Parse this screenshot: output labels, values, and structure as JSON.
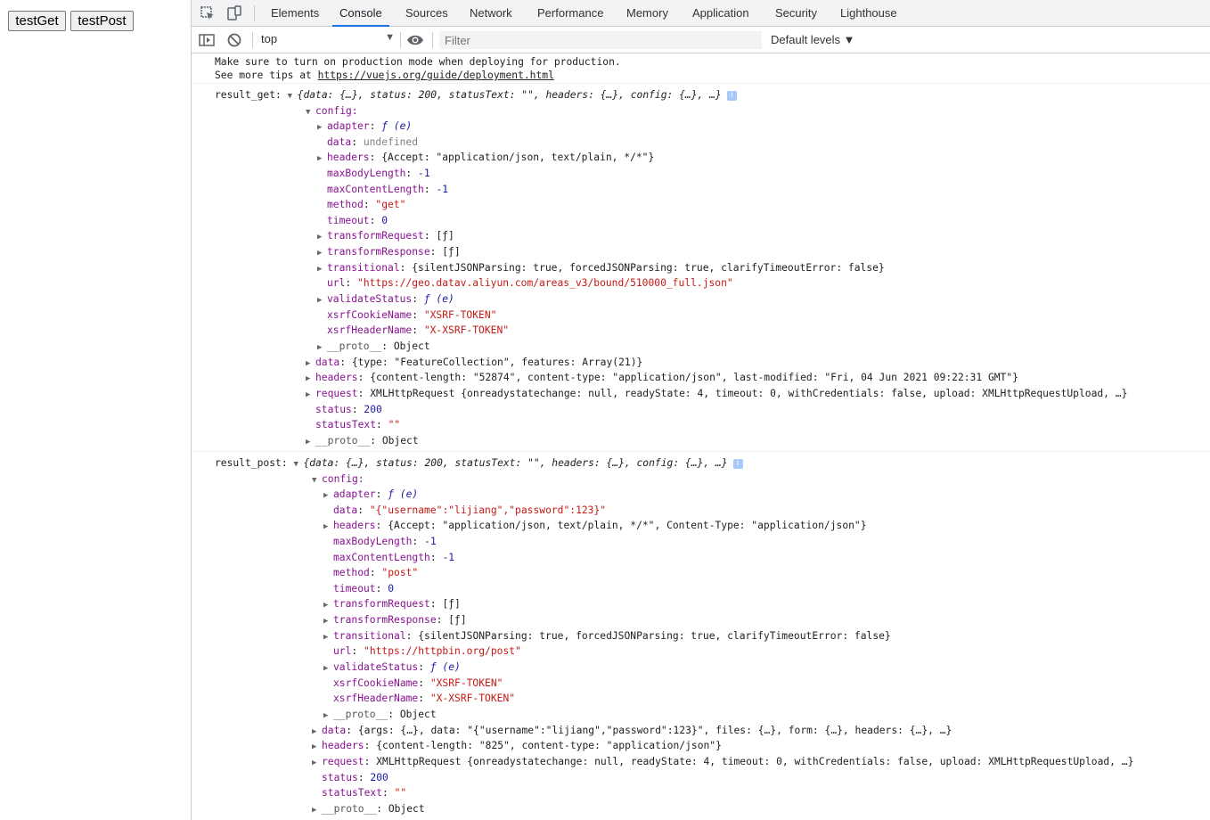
{
  "page": {
    "buttons": [
      "testGet",
      "testPost"
    ]
  },
  "devtools": {
    "tabs": [
      "Elements",
      "Console",
      "Sources",
      "Network",
      "Performance",
      "Memory",
      "Application",
      "Security",
      "Lighthouse"
    ],
    "active_tab": "Console",
    "context": "top",
    "filter_placeholder": "Filter",
    "levels": "Default levels ▼",
    "accent": "#1a73e8"
  },
  "console": {
    "intro": {
      "line1": "Make sure to turn on production mode when deploying for production.",
      "line2_prefix": "See more tips at ",
      "line2_link": "https://vuejs.org/guide/deployment.html"
    },
    "result_get": {
      "label": "result_get:",
      "summary": "{data: {…}, status: 200, statusText: \"\", headers: {…}, config: {…}, …}",
      "config_label": "config:",
      "config": {
        "adapter": "ƒ (e)",
        "data": "undefined",
        "headers": "{Accept: \"application/json, text/plain, */*\"}",
        "maxBodyLength": "-1",
        "maxContentLength": "-1",
        "method": "\"get\"",
        "timeout": "0",
        "transformRequest": "[ƒ]",
        "transformResponse": "[ƒ]",
        "transitional": "{silentJSONParsing: true, forcedJSONParsing: true, clarifyTimeoutError: false}",
        "url": "\"https://geo.datav.aliyun.com/areas_v3/bound/510000_full.json\"",
        "validateStatus": "ƒ (e)",
        "xsrfCookieName": "\"XSRF-TOKEN\"",
        "xsrfHeaderName": "\"X-XSRF-TOKEN\"",
        "__proto__": "Object"
      },
      "data": "{type: \"FeatureCollection\", features: Array(21)}",
      "headers": "{content-length: \"52874\", content-type: \"application/json\", last-modified: \"Fri, 04 Jun 2021 09:22:31 GMT\"}",
      "request": "XMLHttpRequest {onreadystatechange: null, readyState: 4, timeout: 0, withCredentials: false, upload: XMLHttpRequestUpload, …}",
      "status": "200",
      "statusText": "\"\"",
      "proto": "Object"
    },
    "result_post": {
      "label": "result_post:",
      "summary": "{data: {…}, status: 200, statusText: \"\", headers: {…}, config: {…}, …}",
      "config_label": "config:",
      "config": {
        "adapter": "ƒ (e)",
        "data": "\"{\"username\":\"lijiang\",\"password\":123}\"",
        "headers": "{Accept: \"application/json, text/plain, */*\", Content-Type: \"application/json\"}",
        "maxBodyLength": "-1",
        "maxContentLength": "-1",
        "method": "\"post\"",
        "timeout": "0",
        "transformRequest": "[ƒ]",
        "transformResponse": "[ƒ]",
        "transitional": "{silentJSONParsing: true, forcedJSONParsing: true, clarifyTimeoutError: false}",
        "url": "\"https://httpbin.org/post\"",
        "validateStatus": "ƒ (e)",
        "xsrfCookieName": "\"XSRF-TOKEN\"",
        "xsrfHeaderName": "\"X-XSRF-TOKEN\"",
        "__proto__": "Object"
      },
      "data": "{args: {…}, data: \"{\"username\":\"lijiang\",\"password\":123}\", files: {…}, form: {…}, headers: {…}, …}",
      "headers": "{content-length: \"825\", content-type: \"application/json\"}",
      "request": "XMLHttpRequest {onreadystatechange: null, readyState: 4, timeout: 0, withCredentials: false, upload: XMLHttpRequestUpload, …}",
      "status": "200",
      "statusText": "\"\"",
      "proto": "Object"
    }
  }
}
